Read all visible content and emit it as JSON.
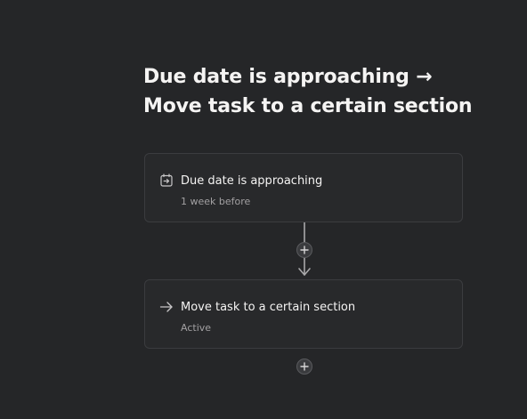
{
  "rule": {
    "title_line1": "Due date is approaching →",
    "title_line2": "Move task to a certain section"
  },
  "trigger": {
    "icon": "calendar-arrow-icon",
    "label": "Due date is approaching",
    "detail": "1 week before"
  },
  "action": {
    "icon": "arrow-right-icon",
    "label": "Move task to a certain section",
    "status": "Active"
  },
  "colors": {
    "background": "#252628",
    "card_border": "#3b3c3f",
    "text_primary": "#f5f4f3",
    "text_secondary": "#a2a0a2"
  }
}
